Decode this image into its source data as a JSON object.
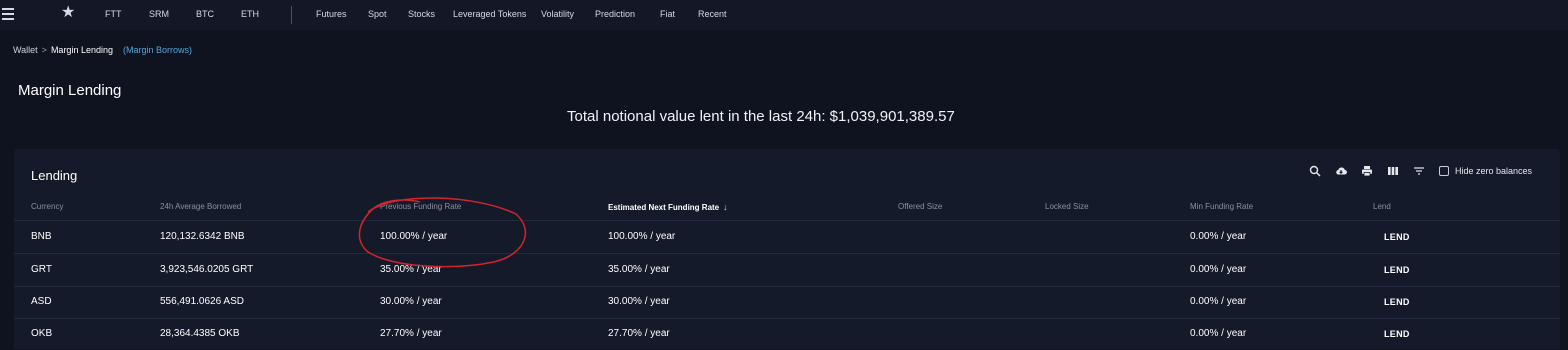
{
  "topbar": {
    "menu_icon": "hamburger-menu-icon",
    "favorites_icon": "star-icon",
    "items": [
      "FTT",
      "SRM",
      "BTC",
      "ETH",
      "Futures",
      "Spot",
      "Stocks",
      "Leveraged Tokens",
      "Volatility",
      "Prediction",
      "Fiat",
      "Recent"
    ]
  },
  "breadcrumb": {
    "root": "Wallet",
    "separator": ">",
    "current": "Margin Lending",
    "alternate": "(Margin Borrows)"
  },
  "page": {
    "title": "Margin Lending",
    "total_lent": "Total notional value lent in the last 24h: $1,039,901,389.57"
  },
  "lending": {
    "title": "Lending",
    "toolbar_icons": [
      "search-icon",
      "cloud-download-icon",
      "print-icon",
      "columns-icon",
      "filter-icon"
    ],
    "hide_zero_label": "Hide zero balances",
    "hide_zero_checked": false,
    "columns": [
      "Currency",
      "24h Average Borrowed",
      "Previous Funding Rate",
      "Estimated Next Funding Rate",
      "Offered Size",
      "Locked Size",
      "Min Funding Rate",
      "Lend"
    ],
    "sorted_column": "Estimated Next Funding Rate",
    "sort_direction": "descending",
    "rows": [
      {
        "currency": "BNB",
        "avg_borrowed": "120,132.6342 BNB",
        "prev_rate": "100.00% / year",
        "next_rate": "100.00% / year",
        "offered": "",
        "locked": "",
        "min_rate": "0.00% / year",
        "action": "LEND"
      },
      {
        "currency": "GRT",
        "avg_borrowed": "3,923,546.0205 GRT",
        "prev_rate": "35.00% / year",
        "next_rate": "35.00% / year",
        "offered": "",
        "locked": "",
        "min_rate": "0.00% / year",
        "action": "LEND"
      },
      {
        "currency": "ASD",
        "avg_borrowed": "556,491.0626 ASD",
        "prev_rate": "30.00% / year",
        "next_rate": "30.00% / year",
        "offered": "",
        "locked": "",
        "min_rate": "0.00% / year",
        "action": "LEND"
      },
      {
        "currency": "OKB",
        "avg_borrowed": "28,364.4385 OKB",
        "prev_rate": "27.70% / year",
        "next_rate": "27.70% / year",
        "offered": "",
        "locked": "",
        "min_rate": "0.00% / year",
        "action": "LEND"
      }
    ]
  },
  "colors": {
    "background": "#0f1320",
    "card": "#151a2a",
    "link": "#55a6d9",
    "annotation": "#d0262b"
  }
}
